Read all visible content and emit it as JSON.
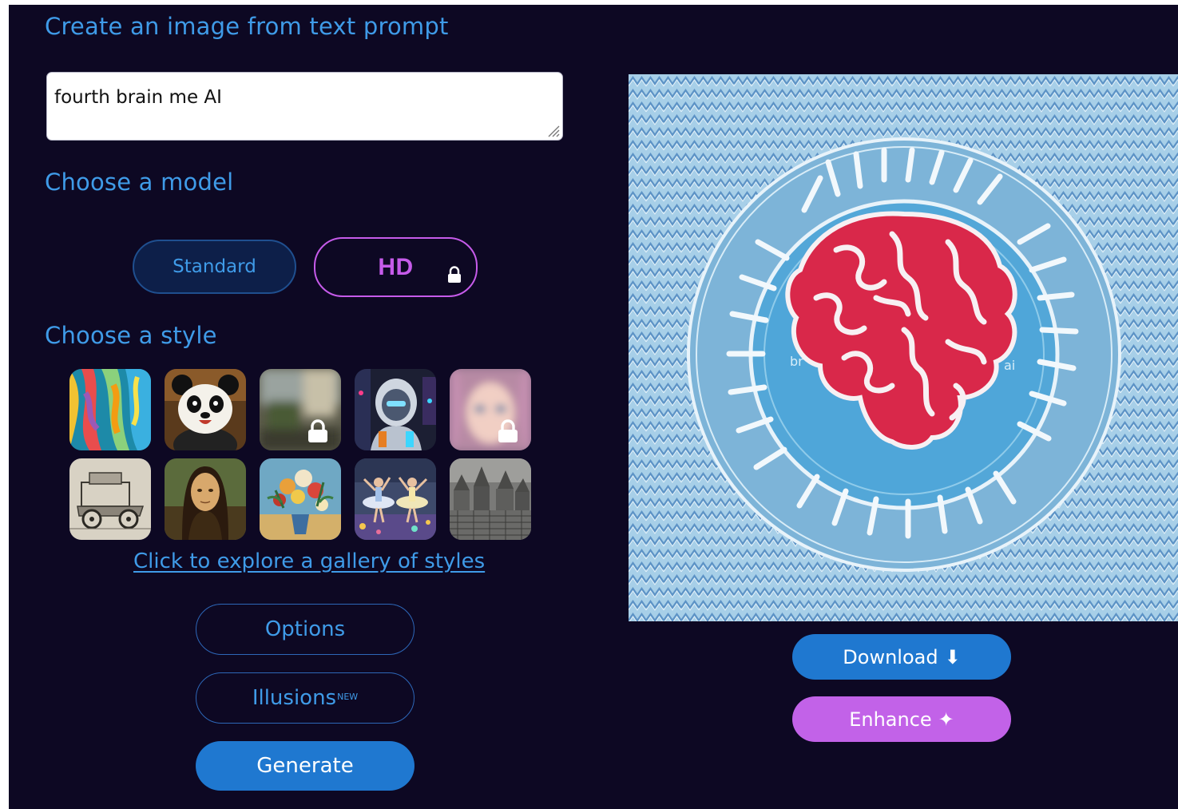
{
  "headings": {
    "create": "Create an image from text prompt",
    "model": "Choose a model",
    "style": "Choose a style"
  },
  "prompt": {
    "value": "fourth brain me AI"
  },
  "models": {
    "standard_label": "Standard",
    "hd_label": "HD",
    "hd_locked": true
  },
  "styles": [
    {
      "name": "abstract-paint",
      "locked": false
    },
    {
      "name": "panda",
      "locked": false
    },
    {
      "name": "blurred-scene",
      "locked": true
    },
    {
      "name": "robot",
      "locked": false
    },
    {
      "name": "anime-portrait",
      "locked": true
    },
    {
      "name": "vintage-car-sketch",
      "locked": false
    },
    {
      "name": "renaissance-portrait",
      "locked": false
    },
    {
      "name": "flower-vase",
      "locked": false
    },
    {
      "name": "ballet-dancers",
      "locked": false
    },
    {
      "name": "city-etching",
      "locked": false
    }
  ],
  "gallery_link": "Click to explore a gallery of styles",
  "buttons": {
    "options": "Options",
    "illusions": "Illusions",
    "illusions_badge": "NEW",
    "generate": "Generate",
    "download": "Download",
    "download_icon": "⬇",
    "enhance": "Enhance",
    "enhance_icon": "✦"
  },
  "colors": {
    "background": "#0d0823",
    "accent_blue": "#3f9be8",
    "button_blue": "#1f78d0",
    "accent_purple": "#c65bea"
  }
}
